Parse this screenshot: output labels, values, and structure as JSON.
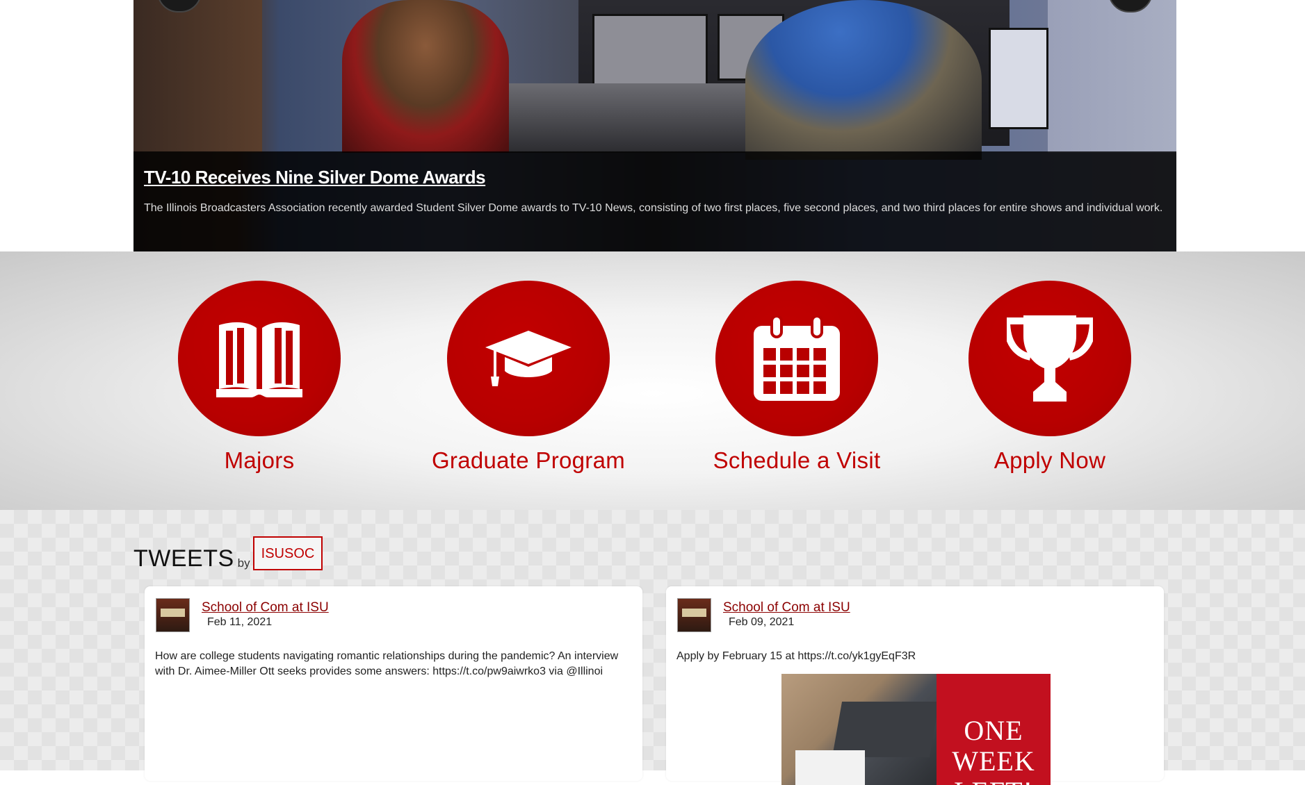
{
  "slider": {
    "headline": "TV-10 Receives Nine Silver Dome Awards",
    "summary": "The Illinois Broadcasters Association recently awarded Student Silver Dome awards to TV-10 News, consisting of two first places, five second places, and two third places for entire shows and individual work."
  },
  "quick_links": [
    {
      "label": "Majors",
      "icon": "open-book-icon"
    },
    {
      "label": "Graduate Program",
      "icon": "graduation-cap-icon"
    },
    {
      "label": "Schedule a Visit",
      "icon": "calendar-icon"
    },
    {
      "label": "Apply Now",
      "icon": "trophy-icon"
    }
  ],
  "tweets": {
    "title": "TWEETS",
    "by": "by",
    "handle": "ISUSOC",
    "items": [
      {
        "author": "School of Com at ISU",
        "date": "Feb 11, 2021",
        "text": "How are college students navigating romantic relationships during the pandemic? An interview with Dr. Aimee-Miller Ott seeks provides some answers: https://t.co/pw9aiwrko3 via @Illinoi"
      },
      {
        "author": "School of Com at ISU",
        "date": "Feb 09, 2021",
        "text": "Apply by February 15 at https://t.co/yk1gyEqF3R",
        "media_text": "ONE WEEK LEFT!"
      }
    ]
  },
  "colors": {
    "accent": "#c00000",
    "accent_dark": "#8b0000"
  }
}
